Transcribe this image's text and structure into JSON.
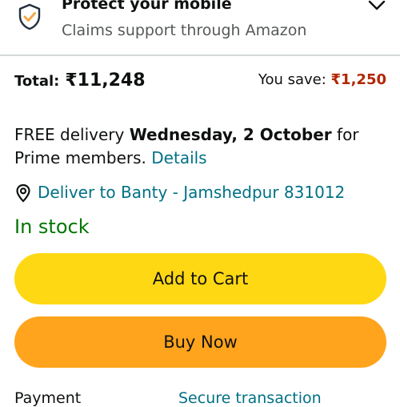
{
  "protect": {
    "title": "Protect your mobile",
    "subtitle": "Claims support through Amazon",
    "icon": "shield-check-icon",
    "expand_icon": "chevron-down-icon"
  },
  "total": {
    "label": "Total:",
    "amount": "₹11,248"
  },
  "savings": {
    "label": "You save:",
    "amount": "₹1,250"
  },
  "delivery": {
    "prefix": "FREE delivery",
    "date": "Wednesday, 2 October",
    "suffix": "for Prime members.",
    "details_link": "Details"
  },
  "location": {
    "icon": "location-pin-icon",
    "text": "Deliver to Banty - Jamshedpur 831012"
  },
  "stock_status": "In stock",
  "buttons": {
    "add_to_cart": "Add to Cart",
    "buy_now": "Buy Now"
  },
  "footer": {
    "left_text": "Payment",
    "right_link": "Secure transaction"
  },
  "colors": {
    "add_to_cart": "#ffd814",
    "buy_now": "#ffa41c",
    "link": "#007185",
    "savings": "#b12704",
    "in_stock": "#007600",
    "shield_accent": "#f3a847"
  }
}
